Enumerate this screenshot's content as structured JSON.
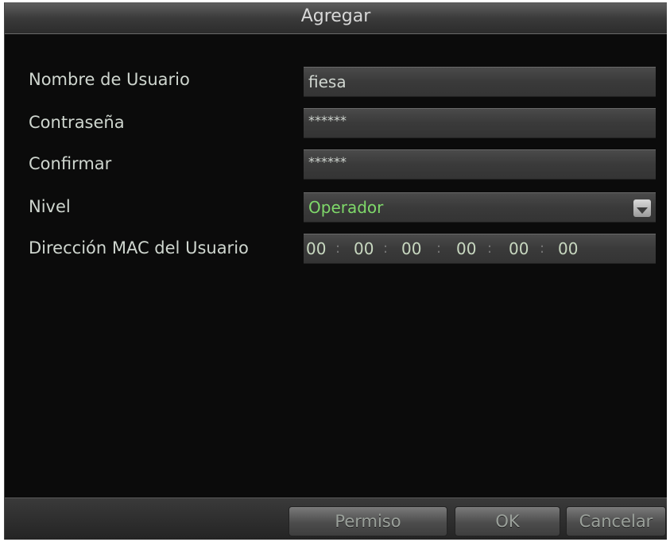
{
  "dialog": {
    "title": "Agregar"
  },
  "form": {
    "username_label": "Nombre de Usuario",
    "username_value": "fiesa",
    "password_label": "Contraseña",
    "password_value": "******",
    "confirm_label": "Confirmar",
    "confirm_value": "******",
    "level_label": "Nivel",
    "level_value": "Operador",
    "mac_label": "Dirección MAC del Usuario",
    "mac_octets": [
      "00",
      "00",
      "00",
      "00",
      "00",
      "00"
    ]
  },
  "buttons": {
    "permission": "Permiso",
    "ok": "OK",
    "cancel": "Cancelar"
  },
  "colors": {
    "background": "#0b0b0b",
    "level_value": "#7fd96a"
  },
  "icons": {
    "level_dropdown": "chevron-down-icon"
  }
}
